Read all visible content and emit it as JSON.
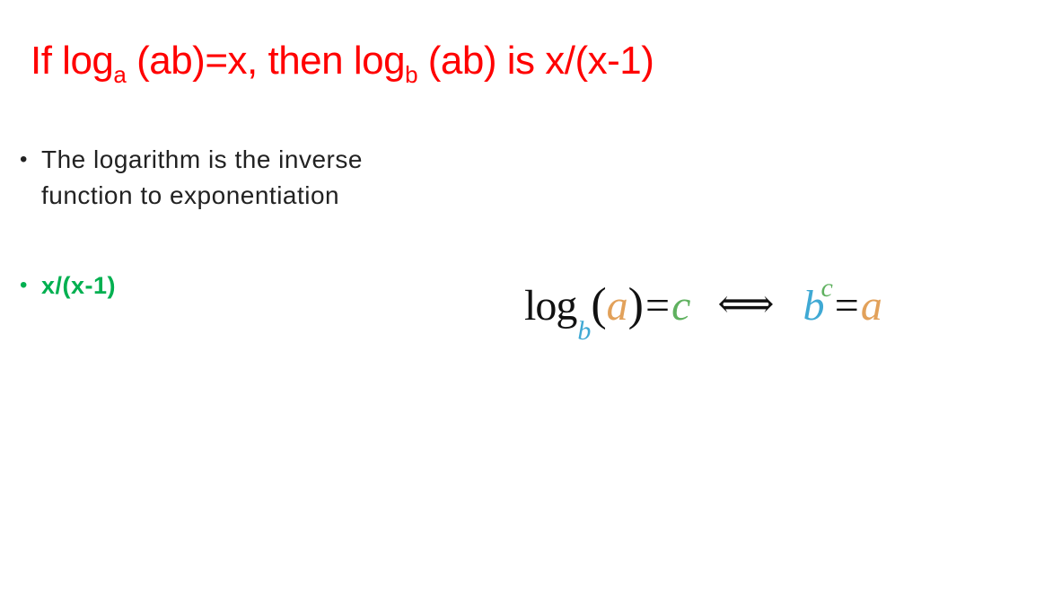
{
  "slide": {
    "title": {
      "part1": "If log",
      "sub1": "a",
      "part2": " (ab)=x, then log",
      "sub2": "b",
      "part3": " (ab) is x/(x-1)"
    },
    "bullets": [
      {
        "text": "The logarithm is the inverse function to exponentiation"
      },
      {
        "text": "x/(x-1)"
      }
    ],
    "formula": {
      "log": "log",
      "base": "b",
      "open_paren": "(",
      "arg": "a",
      "close_paren": ")",
      "equals1": "=",
      "result": "c",
      "iff": "⟺",
      "power_base": "b",
      "power_exp": "c",
      "equals2": "=",
      "power_result": "a"
    },
    "colors": {
      "title": "#ff0000",
      "answer": "#00b050",
      "base": "#3fa9d4",
      "argument": "#e2a15a",
      "result": "#5fb15f"
    }
  }
}
